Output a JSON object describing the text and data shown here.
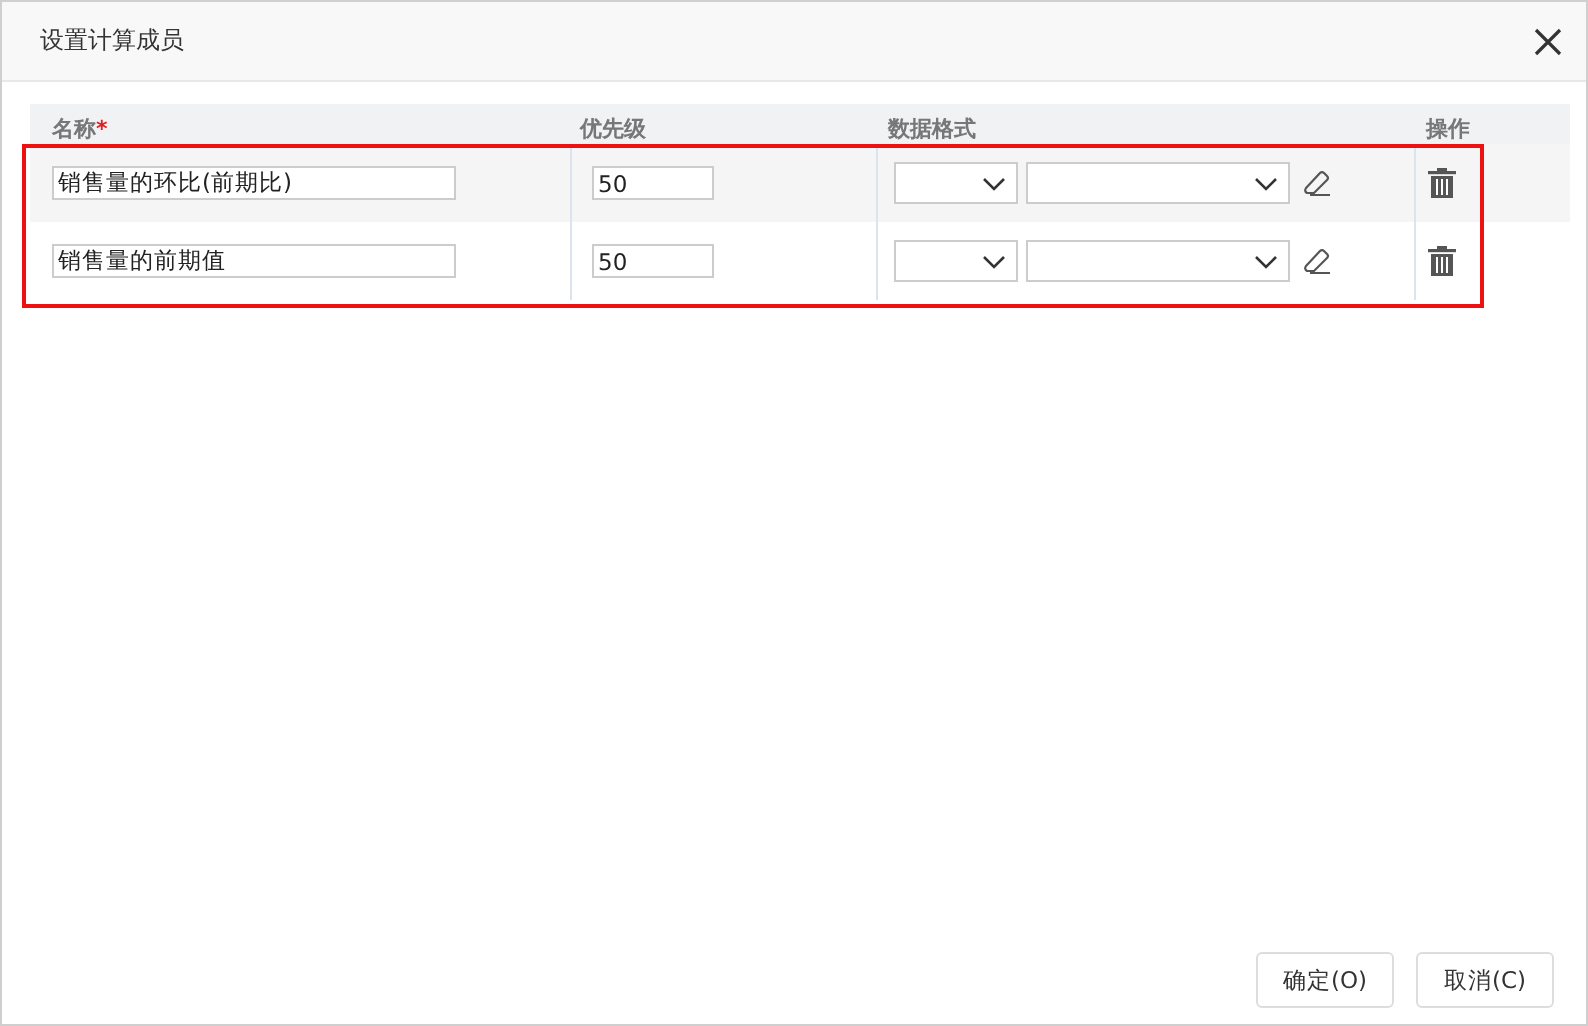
{
  "window": {
    "title": "设置计算成员"
  },
  "table": {
    "highlighted": true,
    "columns": [
      {
        "label": "名称",
        "mark": "*"
      },
      {
        "label": "优先级"
      },
      {
        "label": "数据格式"
      },
      {
        "label": "操作"
      }
    ],
    "rows": [
      {
        "name": "销售量的环比(前期比)",
        "priority": "50"
      },
      {
        "name": "销售量的前期值",
        "priority": "50"
      }
    ]
  },
  "buttons": [
    "确定(O)",
    "取消(C)"
  ]
}
